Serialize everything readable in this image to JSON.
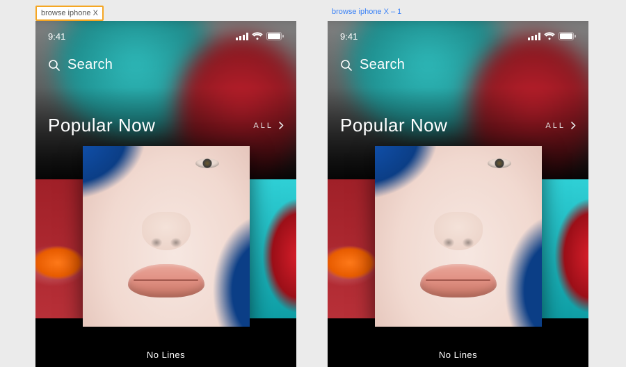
{
  "artboards": {
    "left_label": "browse iphone X",
    "right_label": "browse iphone X – 1"
  },
  "statusbar": {
    "time": "9:41"
  },
  "search": {
    "placeholder": "Search"
  },
  "section": {
    "title": "Popular Now",
    "all_label": "ALL"
  },
  "cards": {
    "center_caption": "No Lines"
  }
}
